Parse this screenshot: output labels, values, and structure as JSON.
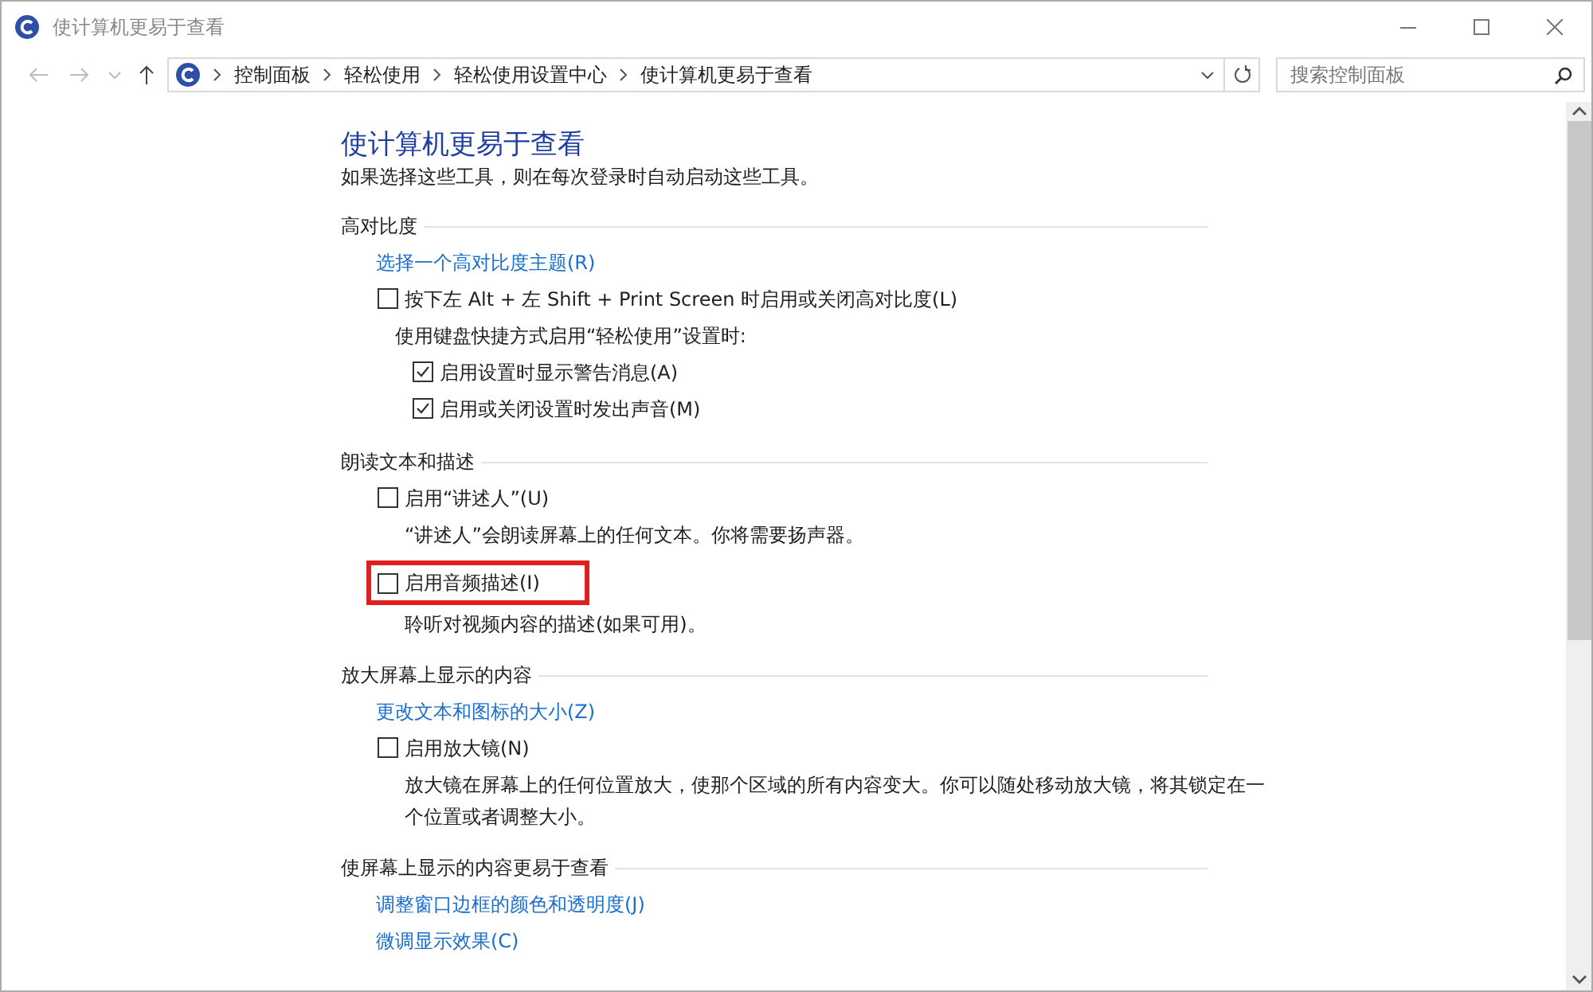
{
  "window": {
    "title": "使计算机更易于查看"
  },
  "breadcrumbs": [
    "控制面板",
    "轻松使用",
    "轻松使用设置中心",
    "使计算机更易于查看"
  ],
  "search": {
    "placeholder": "搜索控制面板"
  },
  "page": {
    "title": "使计算机更易于查看",
    "subtitle": "如果选择这些工具，则在每次登录时自动启动这些工具。"
  },
  "sections": [
    {
      "heading": "高对比度",
      "items": [
        {
          "kind": "link",
          "label": "选择一个高对比度主题(R)"
        },
        {
          "kind": "checkbox",
          "label": "按下左 Alt + 左 Shift + Print Screen 时启用或关闭高对比度(L)",
          "checked": false,
          "highlighted": false,
          "note": "使用键盘快捷方式启用“轻松使用”设置时:",
          "children": [
            {
              "label": "启用设置时显示警告消息(A)",
              "checked": true
            },
            {
              "label": "启用或关闭设置时发出声音(M)",
              "checked": true
            }
          ]
        }
      ]
    },
    {
      "heading": "朗读文本和描述",
      "items": [
        {
          "kind": "checkbox",
          "label": "启用“讲述人”(U)",
          "checked": false,
          "highlighted": false,
          "description": "“讲述人”会朗读屏幕上的任何文本。你将需要扬声器。"
        },
        {
          "kind": "checkbox",
          "label": "启用音频描述(I)",
          "checked": false,
          "highlighted": true,
          "description": "聆听对视频内容的描述(如果可用)。"
        }
      ]
    },
    {
      "heading": "放大屏幕上显示的内容",
      "items": [
        {
          "kind": "link",
          "label": "更改文本和图标的大小(Z)"
        },
        {
          "kind": "checkbox",
          "label": "启用放大镜(N)",
          "checked": false,
          "highlighted": false,
          "description": "放大镜在屏幕上的任何位置放大，使那个区域的所有内容变大。你可以随处移动放大镜，将其锁定在一个位置或者调整大小。"
        }
      ]
    },
    {
      "heading": "使屏幕上显示的内容更易于查看",
      "items": [
        {
          "kind": "link",
          "label": "调整窗口边框的颜色和透明度(J)"
        },
        {
          "kind": "link",
          "label": "微调显示效果(C)"
        }
      ]
    }
  ]
}
